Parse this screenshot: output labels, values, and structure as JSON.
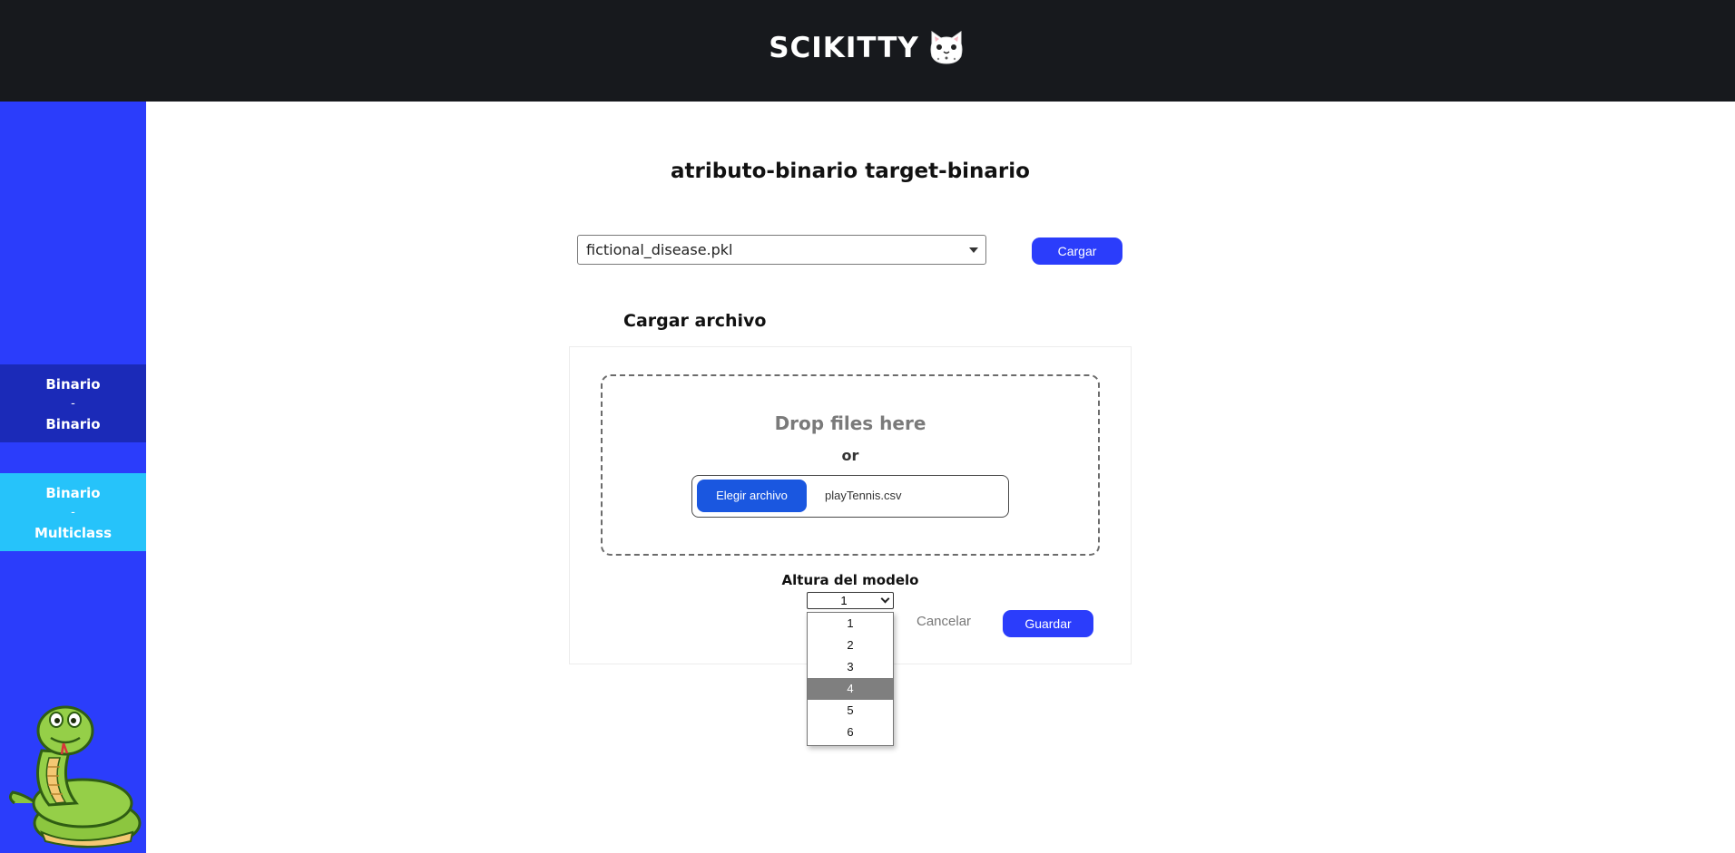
{
  "header": {
    "brand": "SCIKITTY"
  },
  "sidebar": {
    "items": [
      {
        "line1": "Binario",
        "sep": "-",
        "line2": "Binario"
      },
      {
        "line1": "Binario",
        "sep": "-",
        "line2": "Multiclass"
      }
    ]
  },
  "main": {
    "title": "atributo-binario target-binario",
    "model_select": {
      "value": "fictional_disease.pkl"
    },
    "load_button": "Cargar",
    "upload": {
      "heading": "Cargar archivo",
      "drop_text": "Drop files here",
      "or_text": "or",
      "choose_button": "Elegir archivo",
      "file_name": "playTennis.csv"
    },
    "height": {
      "label": "Altura del modelo",
      "value": "1",
      "options": [
        "1",
        "2",
        "3",
        "4",
        "5",
        "6"
      ],
      "highlighted": "4"
    },
    "cancel": "Cancelar",
    "save": "Guardar"
  },
  "colors": {
    "header_bg": "#17191d",
    "sidebar_bg": "#2b3dfb",
    "sidebar_active": "#1b2ab8",
    "sidebar_alt": "#26c3fa",
    "accent": "#2b3dfb"
  }
}
